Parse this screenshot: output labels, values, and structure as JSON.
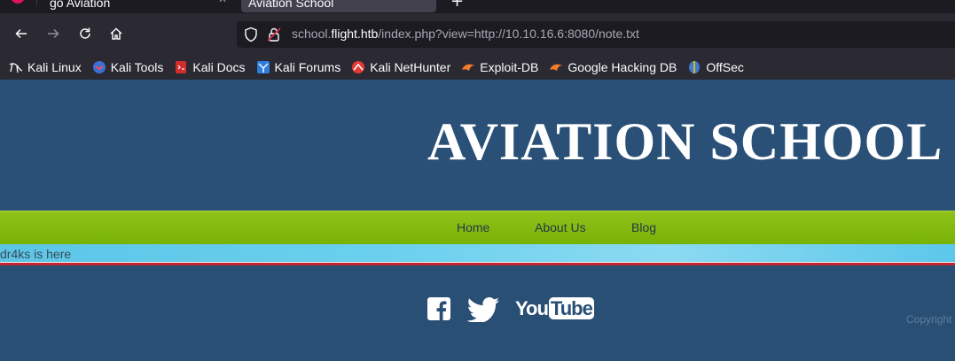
{
  "browser": {
    "tabs": [
      {
        "title": "go Aviation",
        "active": false
      },
      {
        "title": "Aviation School",
        "active": true
      }
    ],
    "new_tab_label": "+",
    "close_glyph": "✕",
    "url": {
      "prefix": "school.",
      "host": "flight.htb",
      "path": "/index.php?view=http://10.10.16.6:8080/note.txt"
    },
    "nav_icons": [
      "back-arrow-icon",
      "forward-arrow-icon",
      "reload-icon",
      "home-icon"
    ],
    "bookmarks": [
      {
        "label": "Kali Linux",
        "icon": "kali-dragon-icon"
      },
      {
        "label": "Kali Tools",
        "icon": "kali-tools-icon"
      },
      {
        "label": "Kali Docs",
        "icon": "kali-docs-icon"
      },
      {
        "label": "Kali Forums",
        "icon": "kali-forums-icon"
      },
      {
        "label": "Kali NetHunter",
        "icon": "nethunter-icon"
      },
      {
        "label": "Exploit-DB",
        "icon": "exploit-db-icon"
      },
      {
        "label": "Google Hacking DB",
        "icon": "ghdb-icon"
      },
      {
        "label": "OffSec",
        "icon": "offsec-icon"
      }
    ]
  },
  "site": {
    "title": "AVIATION SCHOOL",
    "menu": [
      {
        "label": "Home"
      },
      {
        "label": "About Us"
      },
      {
        "label": "Blog"
      }
    ],
    "included_text": "dr4ks is here",
    "social": [
      "facebook-icon",
      "twitter-icon",
      "youtube-icon"
    ],
    "youtube_text": {
      "you": "You",
      "tube": "Tube"
    },
    "copyright": "Copyright"
  },
  "colors": {
    "header_bg": "#2a5078",
    "menu_green": "#80b80a",
    "strip_blue": "#6ad0ee",
    "red_line": "#c3262e",
    "browser_dark": "#1c1b22",
    "toolbar": "#2b2a33"
  }
}
